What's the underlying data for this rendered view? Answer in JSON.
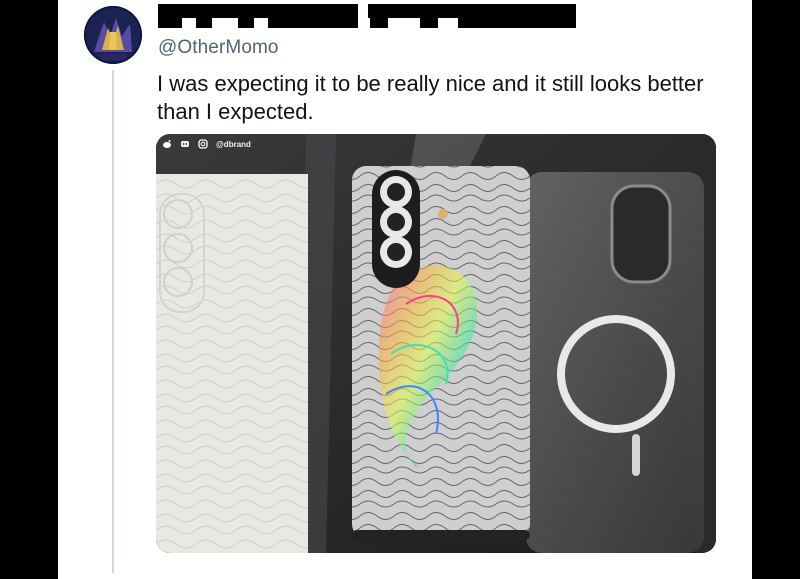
{
  "tweet": {
    "handle": "@OtherMomo",
    "text": "I was expecting it to be really nice and it still looks better than I expected."
  },
  "media": {
    "watermark_handle": "@dbrand",
    "watermark_icons": [
      "reddit-icon",
      "discord-icon",
      "instagram-icon"
    ]
  },
  "colors": {
    "handle": "#536471",
    "text": "#0f1419",
    "thread_line": "#cfd9de"
  }
}
